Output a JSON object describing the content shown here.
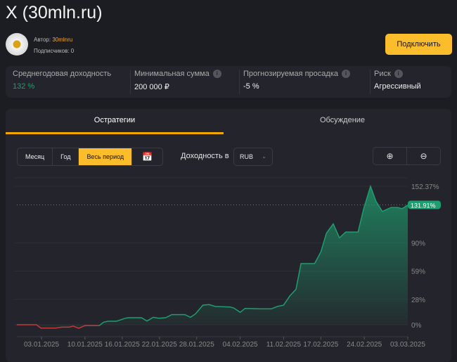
{
  "title": "X (30mln.ru)",
  "author_label": "Автор:",
  "author": "30mlnru",
  "subscribers": "Подписчиков: 0",
  "connect": "Подключить",
  "stats": [
    {
      "label": "Среднегодовая доходность",
      "value": "132 %"
    },
    {
      "label": "Минимальная сумма",
      "value": "200 000 ₽"
    },
    {
      "label": "Прогнозируемая просадка",
      "value": "-5 %"
    },
    {
      "label": "Риск",
      "value": "Агрессивный"
    }
  ],
  "tabs": [
    "Остратегии",
    "Обсуждение"
  ],
  "periods": [
    "Месяц",
    "Год",
    "Весь период"
  ],
  "yield_in": "Доходность в",
  "currency": "RUB",
  "colors": {
    "accent": "#fbbd2c",
    "green": "#1e9e6e",
    "red": "#c0393b"
  },
  "chart_data": {
    "type": "area",
    "x_unit": "days since 01.01.2025",
    "y_ticks": [
      {
        "v": 0,
        "label": "0%"
      },
      {
        "v": 28,
        "label": "28%"
      },
      {
        "v": 59,
        "label": "59%"
      },
      {
        "v": 90,
        "label": "90%"
      },
      {
        "v": 152.37,
        "label": "152.37%"
      }
    ],
    "x_ticks": [
      {
        "d": 2,
        "label": "03.01.2025"
      },
      {
        "d": 9,
        "label": "10.01.2025"
      },
      {
        "d": 15,
        "label": "16.01.2025"
      },
      {
        "d": 21,
        "label": "22.01.2025"
      },
      {
        "d": 27,
        "label": "28.01.2025"
      },
      {
        "d": 34,
        "label": "04.02.2025"
      },
      {
        "d": 41,
        "label": "11.02.2025"
      },
      {
        "d": 47,
        "label": "17.02.2025"
      },
      {
        "d": 54,
        "label": "24.02.2025"
      },
      {
        "d": 61,
        "label": "03.03.2025"
      }
    ],
    "current": {
      "value": 131.91,
      "label": "131.91%"
    },
    "ylim": [
      -5,
      160
    ],
    "points": [
      [
        -2,
        0
      ],
      [
        1.2,
        0
      ],
      [
        1.9,
        -3.6
      ],
      [
        4.3,
        -3.6
      ],
      [
        5.3,
        -2.6
      ],
      [
        6.5,
        -2.6
      ],
      [
        7.1,
        -1.5
      ],
      [
        8,
        -3.9
      ],
      [
        9,
        -1
      ],
      [
        11.3,
        -1
      ],
      [
        12,
        2.8
      ],
      [
        12.7,
        3.9
      ],
      [
        14.1,
        3.9
      ],
      [
        15.5,
        7.2
      ],
      [
        16,
        7.7
      ],
      [
        18.1,
        7.7
      ],
      [
        19,
        4.1
      ],
      [
        20,
        8.2
      ],
      [
        20.9,
        7.2
      ],
      [
        22,
        7.7
      ],
      [
        23,
        11.1
      ],
      [
        25.1,
        11.1
      ],
      [
        26,
        8.2
      ],
      [
        26.8,
        11.9
      ],
      [
        28,
        21.6
      ],
      [
        29,
        22.2
      ],
      [
        30,
        20.1
      ],
      [
        32.4,
        19.6
      ],
      [
        33,
        18.3
      ],
      [
        34,
        13.7
      ],
      [
        34.8,
        18
      ],
      [
        37.1,
        17.5
      ],
      [
        39,
        17.5
      ],
      [
        40,
        20.1
      ],
      [
        41,
        21.6
      ],
      [
        42,
        31.7
      ],
      [
        43,
        38.9
      ],
      [
        43.8,
        67.3
      ],
      [
        46,
        67.3
      ],
      [
        47,
        80.2
      ],
      [
        47.9,
        100.8
      ],
      [
        49,
        111
      ],
      [
        50,
        95.6
      ],
      [
        51,
        102
      ],
      [
        53,
        102
      ],
      [
        53.9,
        127.8
      ],
      [
        55,
        152.3
      ],
      [
        55.9,
        135.6
      ],
      [
        56.9,
        124.7
      ],
      [
        58.3,
        129
      ],
      [
        59.4,
        129
      ],
      [
        60.1,
        127.8
      ],
      [
        61,
        131.7
      ]
    ]
  }
}
